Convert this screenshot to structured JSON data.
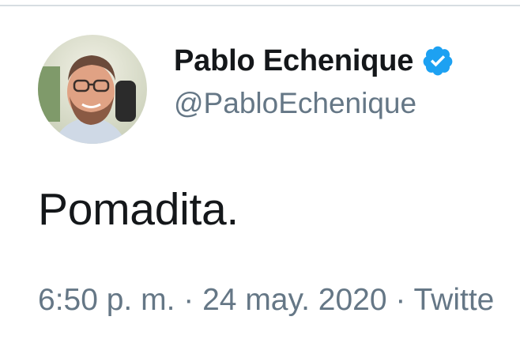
{
  "tweet": {
    "author": {
      "display_name": "Pablo Echenique",
      "handle": "@PabloEchenique",
      "verified": true,
      "verified_icon": "verified-badge-icon",
      "avatar": "profile-photo"
    },
    "text": "Pomadita.",
    "meta": {
      "time": "6:50 p. m.",
      "separator": " · ",
      "date": "24 may. 2020",
      "source": "Twitte"
    }
  },
  "colors": {
    "name": "#14171a",
    "secondary": "#657786",
    "verified": "#1da1f2",
    "divider": "#d7dde2"
  }
}
